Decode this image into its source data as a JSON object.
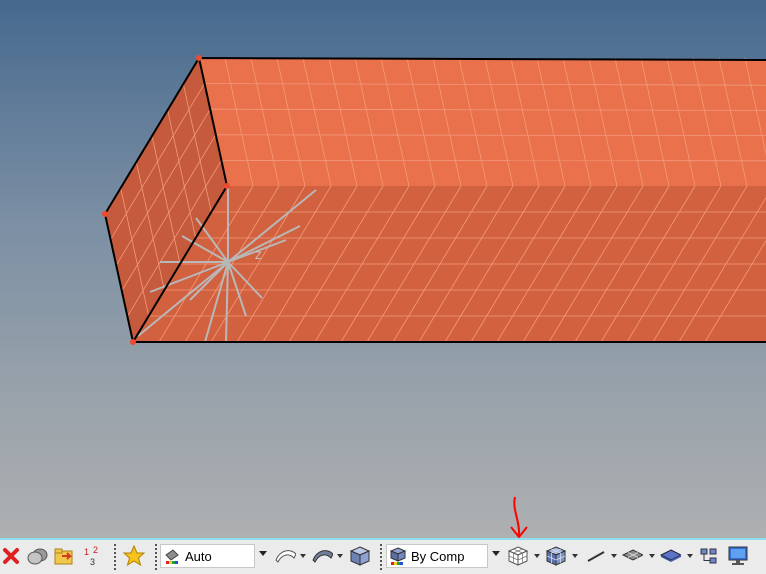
{
  "viewport": {
    "annotation_label": "Z",
    "colors": {
      "bg_top": "#46698e",
      "bg_bottom": "#aeb0b1",
      "mesh_top": "#e9714b",
      "mesh_side": "#c65a3c",
      "mesh_front": "#d2613f",
      "mesh_lines": "#f39a7c",
      "edges": "#000000",
      "nodes": "#f04a2e",
      "pointer": "#ff0000"
    }
  },
  "toolbar": {
    "color_mode_combo": {
      "value": "Auto"
    },
    "display_mode_combo": {
      "value": "By Comp"
    },
    "icons": [
      "delete-icon",
      "components-icon",
      "open-folder-icon",
      "numbers-icon",
      "favorite-star-icon",
      "color-mode-icon",
      "surface-shell-icon",
      "solid-surface-icon",
      "solid-cube-icon",
      "component-color-icon",
      "wireframe-elements-icon",
      "shaded-elements-icon",
      "line-icon",
      "plane-mesh-icon",
      "shaded-plane-icon",
      "tree-view-icon",
      "monitor-icon"
    ]
  }
}
